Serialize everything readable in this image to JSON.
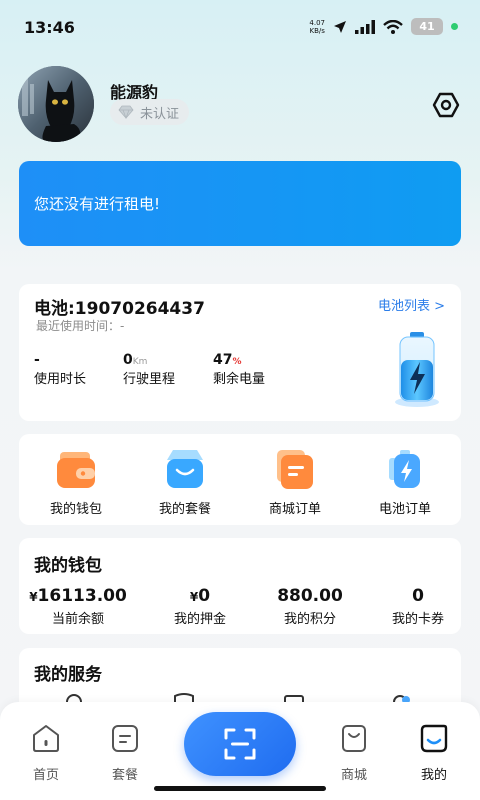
{
  "status_bar": {
    "time": "13:46",
    "net_speed_value": "4.07",
    "net_speed_unit": "KB/s",
    "battery_level": "41"
  },
  "profile": {
    "name": "能源豹",
    "cert_status": "未认证"
  },
  "banner": {
    "text": "您还没有进行租电!"
  },
  "battery": {
    "title": "电池:19070264437",
    "list_link": "电池列表 >",
    "last_used": "最近使用时间：-",
    "stats": [
      {
        "value": "-",
        "unit": "",
        "label": "使用时长"
      },
      {
        "value": "0",
        "unit": "Km",
        "label": "行驶里程"
      },
      {
        "value": "47",
        "unit": "%",
        "label": "剩余电量"
      }
    ]
  },
  "shortcuts": [
    {
      "label": "我的钱包",
      "icon": "wallet-icon"
    },
    {
      "label": "我的套餐",
      "icon": "package-bag-icon"
    },
    {
      "label": "商城订单",
      "icon": "order-document-icon"
    },
    {
      "label": "电池订单",
      "icon": "battery-bolt-icon"
    }
  ],
  "wallet": {
    "title": "我的钱包",
    "items": [
      {
        "currency": "¥",
        "value": "16113.00",
        "label": "当前余额"
      },
      {
        "currency": "¥",
        "value": "0",
        "label": "我的押金"
      },
      {
        "currency": "",
        "value": "880.00",
        "label": "我的积分"
      },
      {
        "currency": "",
        "value": "0",
        "label": "我的卡券"
      }
    ]
  },
  "services": {
    "title": "我的服务"
  },
  "bottom_nav": [
    {
      "label": "首页",
      "icon": "home-icon"
    },
    {
      "label": "套餐",
      "icon": "package-icon"
    },
    {
      "label": "",
      "icon": "scan-icon"
    },
    {
      "label": "商城",
      "icon": "shop-bag-icon"
    },
    {
      "label": "我的",
      "icon": "profile-icon"
    }
  ],
  "colors": {
    "accent": "#1e8ff7",
    "link": "#2b7de9",
    "orange": "#ff8a3d",
    "danger": "#e53935"
  }
}
